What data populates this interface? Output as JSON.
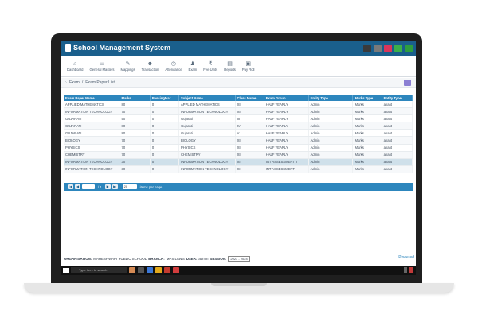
{
  "app": {
    "title": "School Management System"
  },
  "colors": {
    "header": "#1a5f8c",
    "table_header": "#2d86bd",
    "selected_row": "#cfe0ea",
    "accent_purple": "#8b7fd3"
  },
  "toolbar": [
    {
      "label": "Dashboard",
      "icon": "home-icon",
      "glyph": "⌂"
    },
    {
      "label": "General Masters",
      "icon": "monitor-icon",
      "glyph": "▭"
    },
    {
      "label": "Mappings",
      "icon": "wrench-icon",
      "glyph": "✎"
    },
    {
      "label": "Transaction",
      "icon": "users-icon",
      "glyph": "☻"
    },
    {
      "label": "Attendance",
      "icon": "clock-icon",
      "glyph": "◷"
    },
    {
      "label": "Exam",
      "icon": "people-icon",
      "glyph": "♟"
    },
    {
      "label": "Fee Units",
      "icon": "rupee-icon",
      "glyph": "₹"
    },
    {
      "label": "Reports",
      "icon": "document-icon",
      "glyph": "▤"
    },
    {
      "label": "Pay Roll",
      "icon": "payroll-icon",
      "glyph": "▣"
    }
  ],
  "breadcrumb": {
    "home": "Exam",
    "sep": "/",
    "page": "Exam Paper List"
  },
  "table": {
    "columns": [
      "Exam Paper Name",
      "Marks",
      "PassingMar...",
      "Subject Name",
      "Class Name",
      "Exam Group",
      "Entity Type",
      "Marks Type",
      "Entity Type"
    ],
    "rows": [
      [
        "APPLIED MATHEMATICS",
        "80",
        "0",
        "APPLIED MATHEMATICS",
        "XII",
        "HALF YEARLY",
        "Admin",
        "Marks",
        "anant"
      ],
      [
        "INFORMATION TECHNOLOGY",
        "70",
        "0",
        "INFORMATION TECHNOLOGY",
        "XII",
        "HALF YEARLY",
        "Admin",
        "Marks",
        "anant"
      ],
      [
        "GUJARATI",
        "50",
        "0",
        "Gujarati",
        "III",
        "HALF YEARLY",
        "Admin",
        "Marks",
        "anant"
      ],
      [
        "GUJARATI",
        "80",
        "0",
        "Gujarati",
        "IV",
        "HALF YEARLY",
        "Admin",
        "Marks",
        "anant"
      ],
      [
        "GUJARATI",
        "80",
        "0",
        "Gujarati",
        "V",
        "HALF YEARLY",
        "Admin",
        "Marks",
        "anant"
      ],
      [
        "BIOLOGY",
        "70",
        "0",
        "BIOLOGY",
        "XII",
        "HALF YEARLY",
        "Admin",
        "Marks",
        "anant"
      ],
      [
        "PHYSICS",
        "70",
        "0",
        "PHYSICS",
        "XII",
        "HALF YEARLY",
        "Admin",
        "Marks",
        "anant"
      ],
      [
        "CHEMISTRY",
        "70",
        "0",
        "CHEMISTRY",
        "XII",
        "HALF YEARLY",
        "Admin",
        "Marks",
        "anant"
      ],
      [
        "INFORMATION TECHNOLOGY",
        "30",
        "0",
        "INFORMATION TECHNOLOGY",
        "XI",
        "INT ASSESSMENT II",
        "Admin",
        "Marks",
        "anant"
      ],
      [
        "INFORMATION TECHNOLOGY",
        "30",
        "0",
        "INFORMATION TECHNOLOGY",
        "XI",
        "INT ASSESSMENT I",
        "Admin",
        "Marks",
        "anant"
      ]
    ],
    "selected_row": 8
  },
  "pager": {
    "first": "|◀",
    "prev": "◀",
    "of_text": "/ 1",
    "next": "▶",
    "last": "▶|",
    "page_size": "20",
    "per_page_text": "items per page"
  },
  "footer": {
    "org_label": "ORGANISATION:",
    "org_value": "MAHESHWARI PUBLIC SCHOOL",
    "branch_label": "BRANCH:",
    "branch_value": "MPS LAWS",
    "user_label": "USER:",
    "user_value": "admin",
    "session_label": "SESSION:",
    "session_value": "2023 - 2024",
    "powered": "Powered"
  },
  "taskbar": {
    "search_placeholder": "Type here to search"
  }
}
